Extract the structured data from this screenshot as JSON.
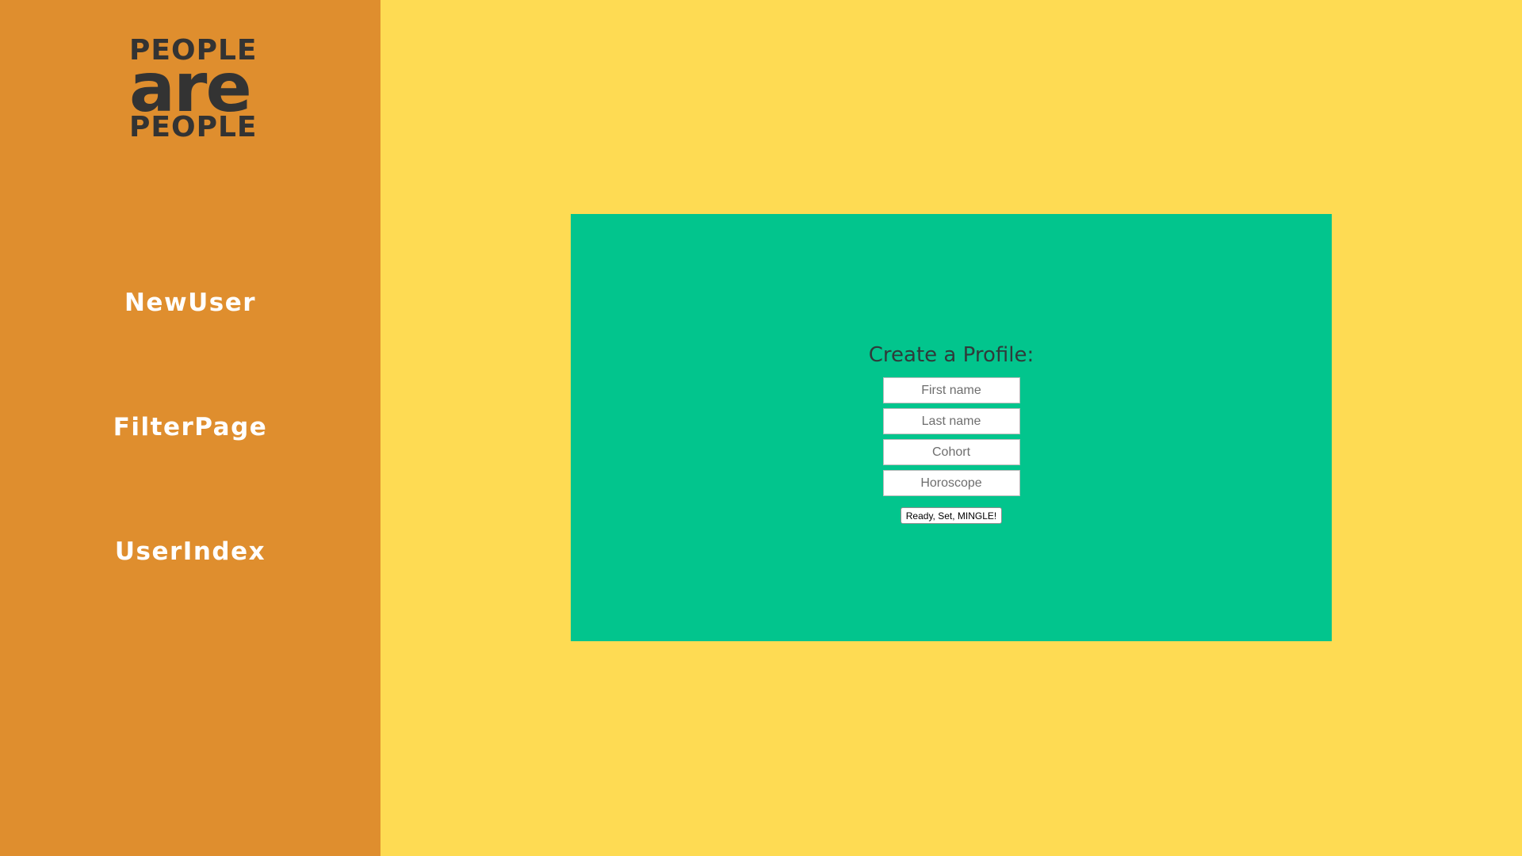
{
  "logo": {
    "line1": "PEOPLE",
    "line2": "are",
    "line3": "PEOPLE"
  },
  "sidebar": {
    "items": [
      {
        "label": "NewUser"
      },
      {
        "label": "FilterPage"
      },
      {
        "label": "UserIndex"
      }
    ]
  },
  "form": {
    "title": "Create a Profile:",
    "fields": [
      {
        "placeholder": "First name",
        "value": ""
      },
      {
        "placeholder": "Last name",
        "value": ""
      },
      {
        "placeholder": "Cohort",
        "value": ""
      },
      {
        "placeholder": "Horoscope",
        "value": ""
      }
    ],
    "submit_label": "Ready, Set, MINGLE!"
  },
  "colors": {
    "sidebar": "#df8e2e",
    "background": "#fedb53",
    "card": "#02c58d",
    "logo_text": "#333333",
    "nav_text": "#ffffff"
  }
}
